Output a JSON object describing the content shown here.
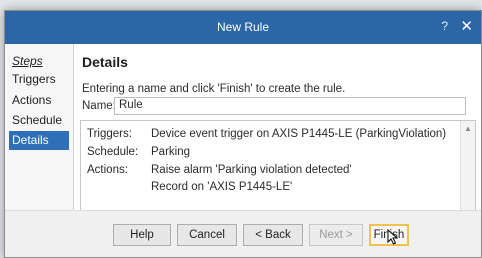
{
  "window": {
    "title": "New Rule",
    "help_glyph": "?",
    "close_glyph": "✕"
  },
  "steps": {
    "heading": "Steps",
    "items": [
      {
        "label": "Triggers",
        "selected": false
      },
      {
        "label": "Actions",
        "selected": false
      },
      {
        "label": "Schedule",
        "selected": false
      },
      {
        "label": "Details",
        "selected": true
      }
    ]
  },
  "details": {
    "heading": "Details",
    "hint": "Entering a name and click 'Finish' to create the rule.",
    "name_label": "Name:",
    "name_value": "Rule"
  },
  "summary": {
    "triggers_label": "Triggers:",
    "triggers_value": "Device event trigger on AXIS P1445-LE (ParkingViolation)",
    "schedule_label": "Schedule:",
    "schedule_value": "Parking",
    "actions_label": "Actions:",
    "actions_value_1": "Raise alarm 'Parking violation detected'",
    "actions_value_2": "Record on 'AXIS P1445-LE'"
  },
  "buttons": {
    "help": "Help",
    "cancel": "Cancel",
    "back": "< Back",
    "next": "Next >",
    "finish": "Finish"
  },
  "colors": {
    "titlebar": "#2b66a6",
    "selected_step": "#2f6fb7",
    "finish_focus": "#f2c14e"
  }
}
